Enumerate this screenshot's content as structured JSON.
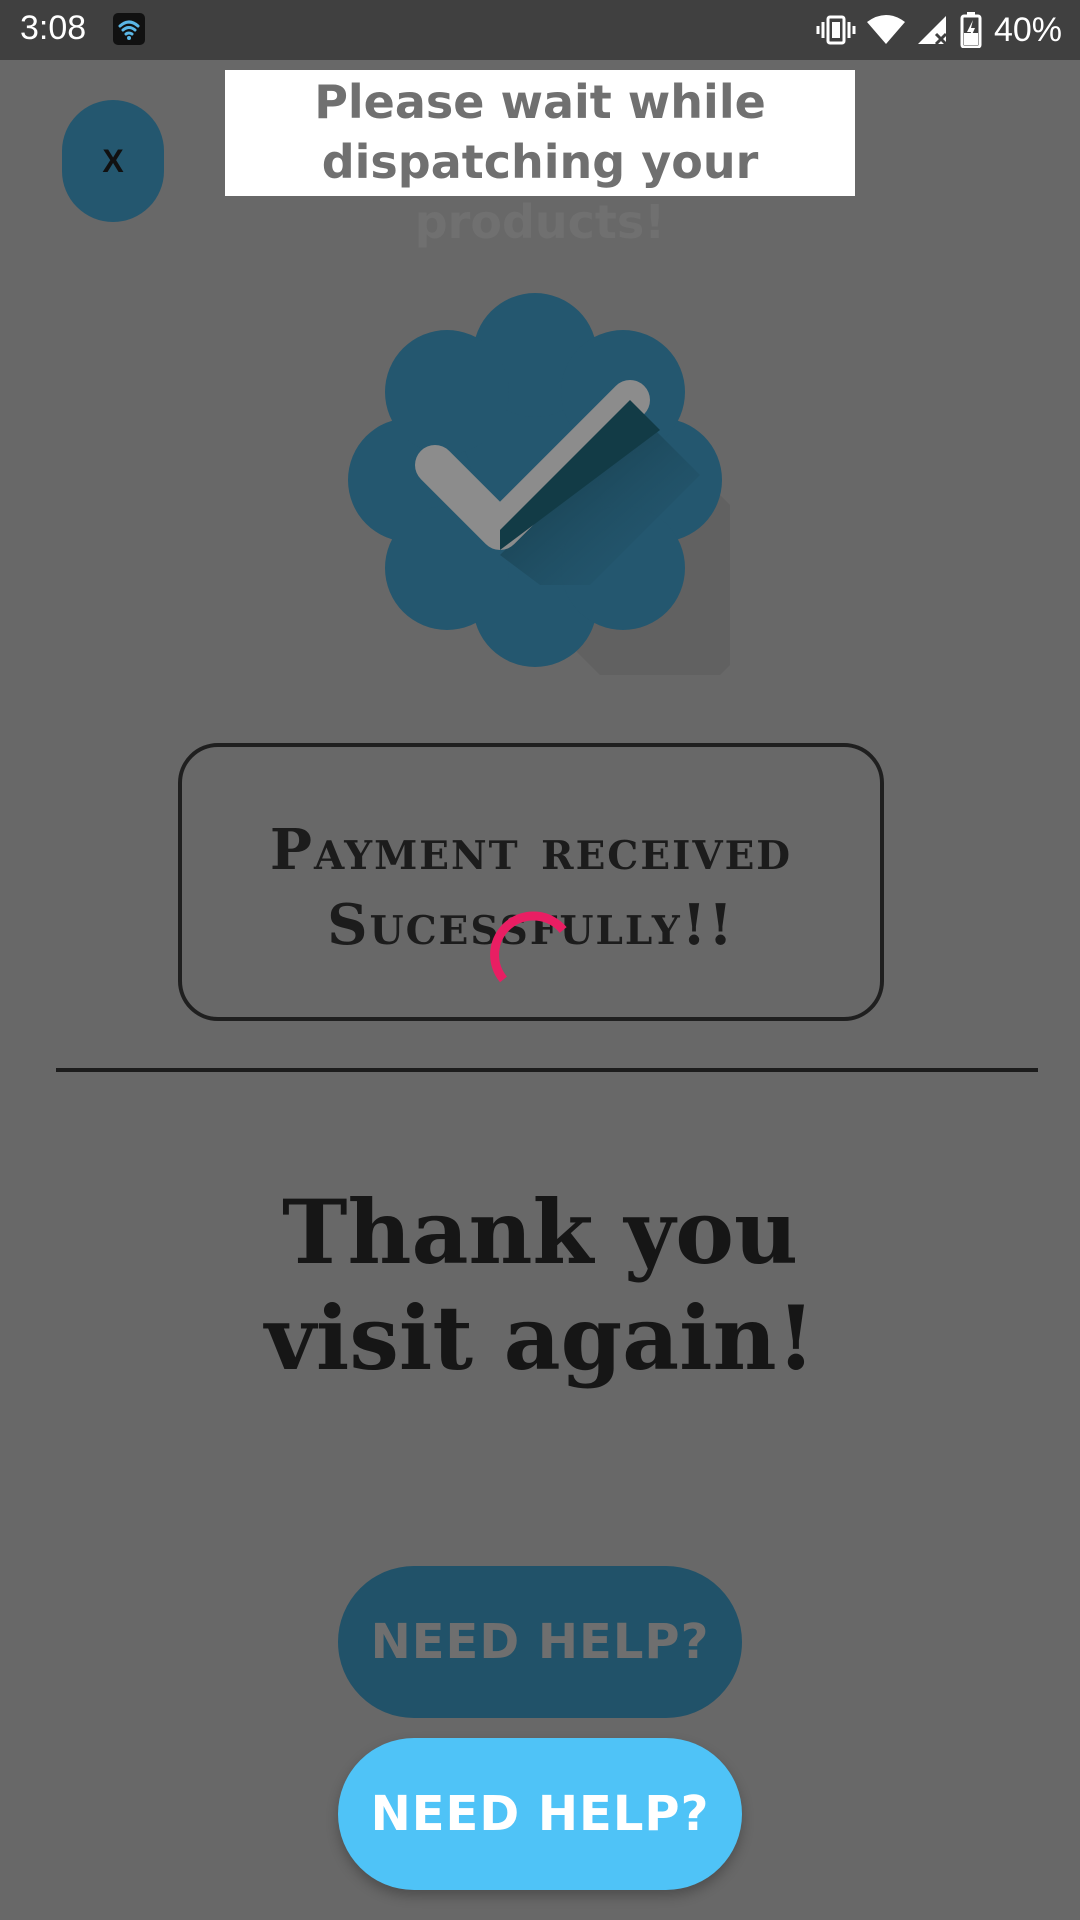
{
  "status_bar": {
    "time": "3:08",
    "battery_text": "40%",
    "icons": [
      "wifi-notification-icon",
      "vibrate-icon",
      "wifi-icon",
      "signal-icon",
      "battery-charging-icon"
    ]
  },
  "close_button": {
    "label": "X"
  },
  "message": {
    "line1": "Please wait while",
    "line2": "dispatching your products!"
  },
  "badge": {
    "icon": "verified-check-badge-icon",
    "color": "#24576f"
  },
  "payment": {
    "line1": "Payment received",
    "line2": "Sucessfully!!"
  },
  "spinner": {
    "icon": "loading-spinner-icon",
    "color": "#e91e63"
  },
  "thanks": {
    "line1": "Thank you",
    "line2": "visit again!"
  },
  "help_button_dim": {
    "label": "NEED HELP?"
  },
  "help_button": {
    "label": "NEED HELP?",
    "color": "#4fc3f7"
  },
  "colors": {
    "overlay_background": "#686868",
    "status_bar": "#404040"
  }
}
